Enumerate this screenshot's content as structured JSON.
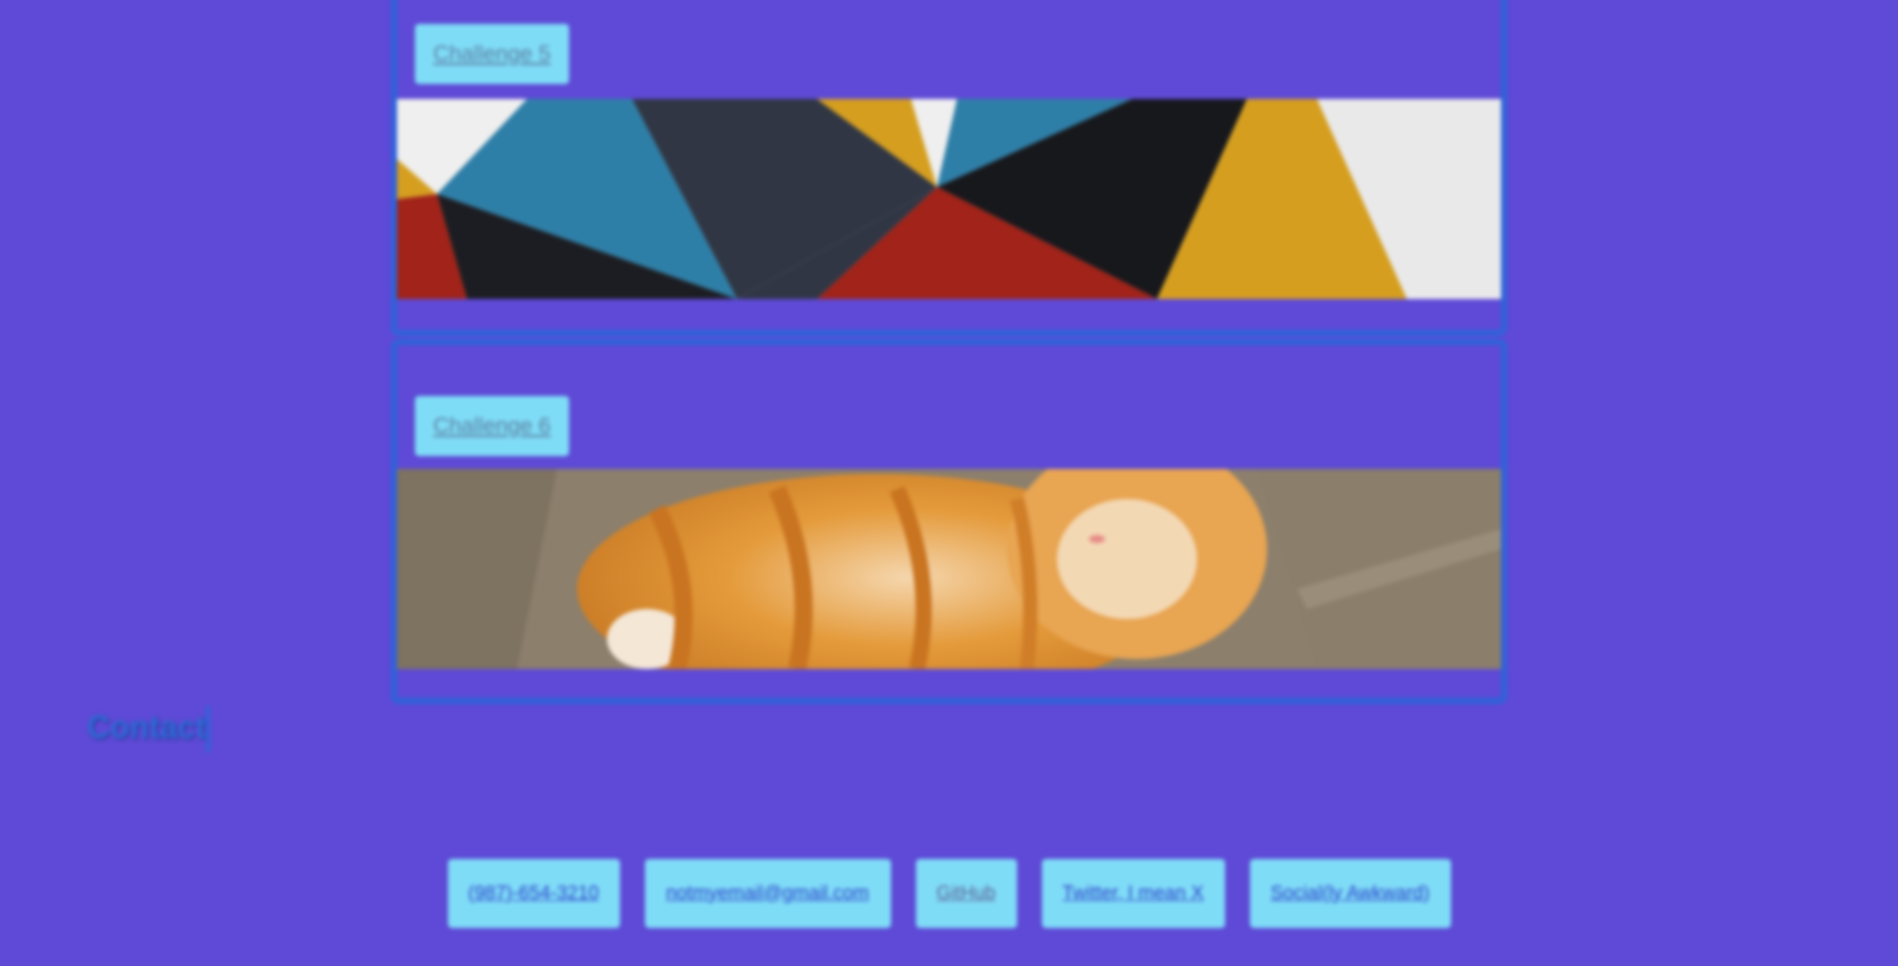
{
  "challenges": [
    {
      "label": "Challenge 5",
      "banner": "geometric-triangles-banner"
    },
    {
      "label": "Challenge 6",
      "banner": "orange-cat-photo"
    }
  ],
  "contact": {
    "heading": "Contact",
    "links": [
      {
        "label": "(987)-654-3210"
      },
      {
        "label": "notmyemail@gmail.com"
      },
      {
        "label": "GitHub"
      },
      {
        "label": "Twitter, I mean X"
      },
      {
        "label": "Social(ly Awkward)"
      }
    ]
  },
  "colors": {
    "background": "#5e4ad6",
    "card_border": "#2f63d9",
    "button_bg": "#7fdcf7",
    "link_text": "#2b3fc9",
    "heading": "#2f6ad6"
  }
}
